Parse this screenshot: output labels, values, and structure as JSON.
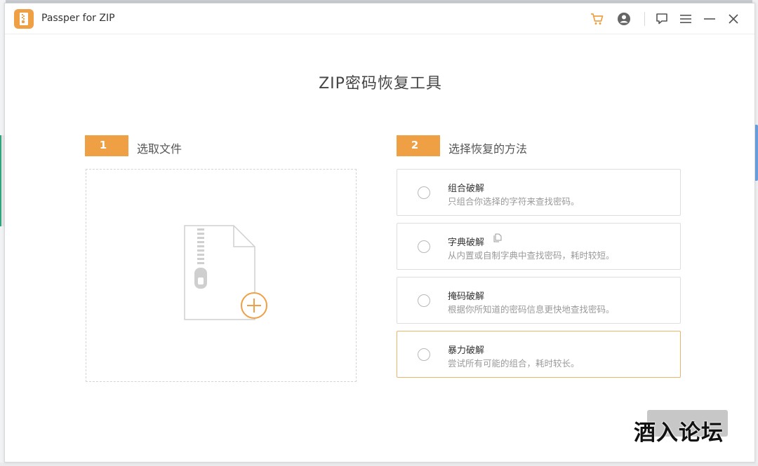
{
  "window": {
    "title": "Passper for ZIP",
    "icons": [
      "cart-icon",
      "account-icon",
      "feedback-icon",
      "menu-icon",
      "minimize-icon",
      "close-icon"
    ],
    "accent_color": "#f0a044"
  },
  "main": {
    "title": "ZIP密码恢复工具",
    "step1": {
      "number": "1",
      "label": "选取文件"
    },
    "step2": {
      "number": "2",
      "label": "选择恢复的方法"
    },
    "methods": [
      {
        "title": "组合破解",
        "desc": "只组合你选择的字符来查找密码。",
        "selected": false
      },
      {
        "title": "字典破解",
        "desc": "从内置或自制字典中查找密码，耗时较短。",
        "selected": false
      },
      {
        "title": "掩码破解",
        "desc": "根据你所知道的密码信息更快地查找密码。",
        "selected": false
      },
      {
        "title": "暴力破解",
        "desc": "尝试所有可能的组合，耗时较长。",
        "selected": false
      }
    ]
  },
  "watermark": "酒入论坛"
}
